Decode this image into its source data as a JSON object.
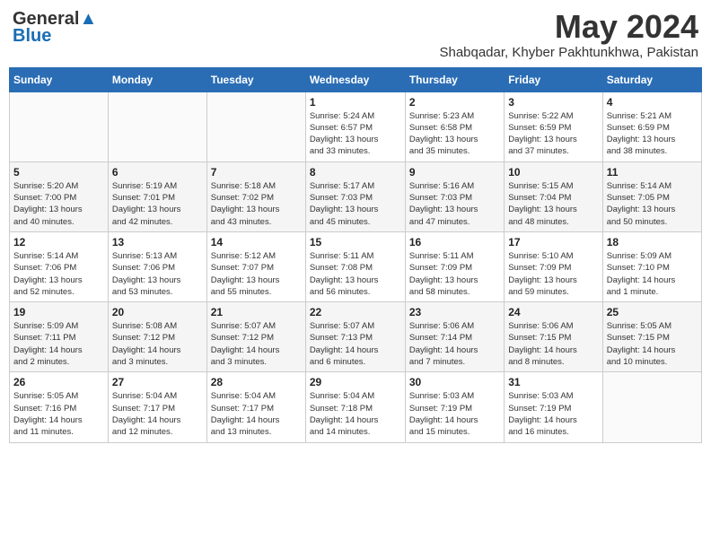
{
  "header": {
    "logo_line1": "General",
    "logo_line2": "Blue",
    "month": "May 2024",
    "location": "Shabqadar, Khyber Pakhtunkhwa, Pakistan"
  },
  "weekdays": [
    "Sunday",
    "Monday",
    "Tuesday",
    "Wednesday",
    "Thursday",
    "Friday",
    "Saturday"
  ],
  "weeks": [
    [
      {
        "day": "",
        "info": ""
      },
      {
        "day": "",
        "info": ""
      },
      {
        "day": "",
        "info": ""
      },
      {
        "day": "1",
        "info": "Sunrise: 5:24 AM\nSunset: 6:57 PM\nDaylight: 13 hours\nand 33 minutes."
      },
      {
        "day": "2",
        "info": "Sunrise: 5:23 AM\nSunset: 6:58 PM\nDaylight: 13 hours\nand 35 minutes."
      },
      {
        "day": "3",
        "info": "Sunrise: 5:22 AM\nSunset: 6:59 PM\nDaylight: 13 hours\nand 37 minutes."
      },
      {
        "day": "4",
        "info": "Sunrise: 5:21 AM\nSunset: 6:59 PM\nDaylight: 13 hours\nand 38 minutes."
      }
    ],
    [
      {
        "day": "5",
        "info": "Sunrise: 5:20 AM\nSunset: 7:00 PM\nDaylight: 13 hours\nand 40 minutes."
      },
      {
        "day": "6",
        "info": "Sunrise: 5:19 AM\nSunset: 7:01 PM\nDaylight: 13 hours\nand 42 minutes."
      },
      {
        "day": "7",
        "info": "Sunrise: 5:18 AM\nSunset: 7:02 PM\nDaylight: 13 hours\nand 43 minutes."
      },
      {
        "day": "8",
        "info": "Sunrise: 5:17 AM\nSunset: 7:03 PM\nDaylight: 13 hours\nand 45 minutes."
      },
      {
        "day": "9",
        "info": "Sunrise: 5:16 AM\nSunset: 7:03 PM\nDaylight: 13 hours\nand 47 minutes."
      },
      {
        "day": "10",
        "info": "Sunrise: 5:15 AM\nSunset: 7:04 PM\nDaylight: 13 hours\nand 48 minutes."
      },
      {
        "day": "11",
        "info": "Sunrise: 5:14 AM\nSunset: 7:05 PM\nDaylight: 13 hours\nand 50 minutes."
      }
    ],
    [
      {
        "day": "12",
        "info": "Sunrise: 5:14 AM\nSunset: 7:06 PM\nDaylight: 13 hours\nand 52 minutes."
      },
      {
        "day": "13",
        "info": "Sunrise: 5:13 AM\nSunset: 7:06 PM\nDaylight: 13 hours\nand 53 minutes."
      },
      {
        "day": "14",
        "info": "Sunrise: 5:12 AM\nSunset: 7:07 PM\nDaylight: 13 hours\nand 55 minutes."
      },
      {
        "day": "15",
        "info": "Sunrise: 5:11 AM\nSunset: 7:08 PM\nDaylight: 13 hours\nand 56 minutes."
      },
      {
        "day": "16",
        "info": "Sunrise: 5:11 AM\nSunset: 7:09 PM\nDaylight: 13 hours\nand 58 minutes."
      },
      {
        "day": "17",
        "info": "Sunrise: 5:10 AM\nSunset: 7:09 PM\nDaylight: 13 hours\nand 59 minutes."
      },
      {
        "day": "18",
        "info": "Sunrise: 5:09 AM\nSunset: 7:10 PM\nDaylight: 14 hours\nand 1 minute."
      }
    ],
    [
      {
        "day": "19",
        "info": "Sunrise: 5:09 AM\nSunset: 7:11 PM\nDaylight: 14 hours\nand 2 minutes."
      },
      {
        "day": "20",
        "info": "Sunrise: 5:08 AM\nSunset: 7:12 PM\nDaylight: 14 hours\nand 3 minutes."
      },
      {
        "day": "21",
        "info": "Sunrise: 5:07 AM\nSunset: 7:12 PM\nDaylight: 14 hours\nand 3 minutes."
      },
      {
        "day": "22",
        "info": "Sunrise: 5:07 AM\nSunset: 7:13 PM\nDaylight: 14 hours\nand 6 minutes."
      },
      {
        "day": "23",
        "info": "Sunrise: 5:06 AM\nSunset: 7:14 PM\nDaylight: 14 hours\nand 7 minutes."
      },
      {
        "day": "24",
        "info": "Sunrise: 5:06 AM\nSunset: 7:15 PM\nDaylight: 14 hours\nand 8 minutes."
      },
      {
        "day": "25",
        "info": "Sunrise: 5:05 AM\nSunset: 7:15 PM\nDaylight: 14 hours\nand 10 minutes."
      }
    ],
    [
      {
        "day": "26",
        "info": "Sunrise: 5:05 AM\nSunset: 7:16 PM\nDaylight: 14 hours\nand 11 minutes."
      },
      {
        "day": "27",
        "info": "Sunrise: 5:04 AM\nSunset: 7:17 PM\nDaylight: 14 hours\nand 12 minutes."
      },
      {
        "day": "28",
        "info": "Sunrise: 5:04 AM\nSunset: 7:17 PM\nDaylight: 14 hours\nand 13 minutes."
      },
      {
        "day": "29",
        "info": "Sunrise: 5:04 AM\nSunset: 7:18 PM\nDaylight: 14 hours\nand 14 minutes."
      },
      {
        "day": "30",
        "info": "Sunrise: 5:03 AM\nSunset: 7:19 PM\nDaylight: 14 hours\nand 15 minutes."
      },
      {
        "day": "31",
        "info": "Sunrise: 5:03 AM\nSunset: 7:19 PM\nDaylight: 14 hours\nand 16 minutes."
      },
      {
        "day": "",
        "info": ""
      }
    ]
  ]
}
